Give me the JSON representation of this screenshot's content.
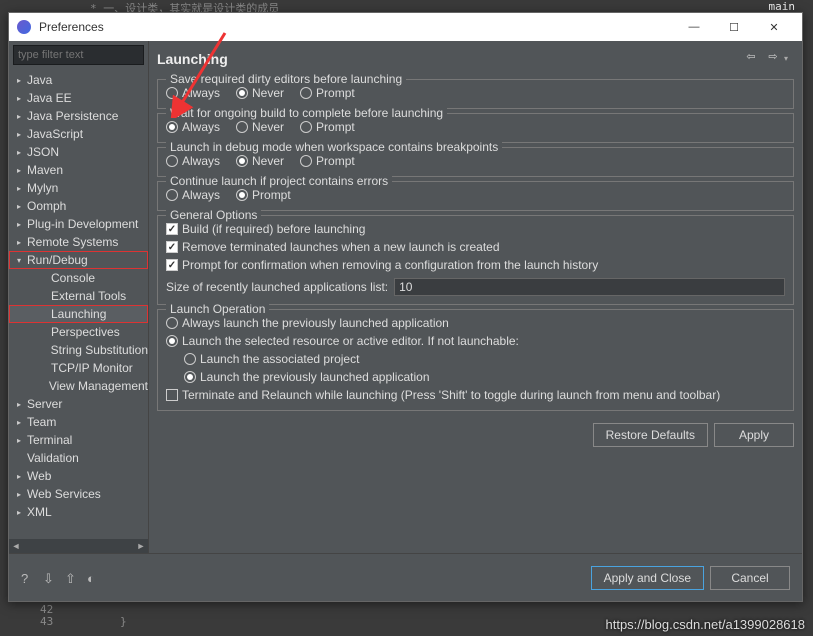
{
  "window": {
    "title": "Preferences"
  },
  "filter": {
    "placeholder": "type filter text"
  },
  "tree": [
    {
      "label": "Java",
      "twisty": "▸",
      "indent": 0
    },
    {
      "label": "Java EE",
      "twisty": "▸",
      "indent": 0
    },
    {
      "label": "Java Persistence",
      "twisty": "▸",
      "indent": 0
    },
    {
      "label": "JavaScript",
      "twisty": "▸",
      "indent": 0
    },
    {
      "label": "JSON",
      "twisty": "▸",
      "indent": 0
    },
    {
      "label": "Maven",
      "twisty": "▸",
      "indent": 0
    },
    {
      "label": "Mylyn",
      "twisty": "▸",
      "indent": 0
    },
    {
      "label": "Oomph",
      "twisty": "▸",
      "indent": 0
    },
    {
      "label": "Plug-in Development",
      "twisty": "▸",
      "indent": 0
    },
    {
      "label": "Remote Systems",
      "twisty": "▸",
      "indent": 0
    },
    {
      "label": "Run/Debug",
      "twisty": "▾",
      "indent": 0,
      "hl": true
    },
    {
      "label": "Console",
      "twisty": "",
      "indent": 1
    },
    {
      "label": "External Tools",
      "twisty": "",
      "indent": 1
    },
    {
      "label": "Launching",
      "twisty": "",
      "indent": 1,
      "sel": true
    },
    {
      "label": "Perspectives",
      "twisty": "",
      "indent": 1
    },
    {
      "label": "String Substitution",
      "twisty": "",
      "indent": 1
    },
    {
      "label": "TCP/IP Monitor",
      "twisty": "",
      "indent": 1
    },
    {
      "label": "View Management",
      "twisty": "",
      "indent": 1
    },
    {
      "label": "Server",
      "twisty": "▸",
      "indent": 0
    },
    {
      "label": "Team",
      "twisty": "▸",
      "indent": 0
    },
    {
      "label": "Terminal",
      "twisty": "▸",
      "indent": 0
    },
    {
      "label": "Validation",
      "twisty": "",
      "indent": 0
    },
    {
      "label": "Web",
      "twisty": "▸",
      "indent": 0
    },
    {
      "label": "Web Services",
      "twisty": "▸",
      "indent": 0
    },
    {
      "label": "XML",
      "twisty": "▸",
      "indent": 0
    }
  ],
  "content": {
    "title": "Launching",
    "groups": {
      "save": {
        "legend": "Save required dirty editors before launching",
        "options": [
          "Always",
          "Never",
          "Prompt"
        ],
        "selected": 1
      },
      "wait": {
        "legend": "Wait for ongoing build to complete before launching",
        "options": [
          "Always",
          "Never",
          "Prompt"
        ],
        "selected": 0
      },
      "debug": {
        "legend": "Launch in debug mode when workspace contains breakpoints",
        "options": [
          "Always",
          "Never",
          "Prompt"
        ],
        "selected": 1
      },
      "errors": {
        "legend": "Continue launch if project contains errors",
        "options": [
          "Always",
          "Prompt"
        ],
        "selected": 1
      },
      "general": {
        "legend": "General Options",
        "checks": [
          {
            "label": "Build (if required) before launching",
            "on": true
          },
          {
            "label": "Remove terminated launches when a new launch is created",
            "on": true
          },
          {
            "label": "Prompt for confirmation when removing a configuration from the launch history",
            "on": true
          }
        ],
        "size_label": "Size of recently launched applications list:",
        "size_value": "10"
      },
      "operation": {
        "legend": "Launch Operation",
        "opt_prev": "Always launch the previously launched application",
        "opt_sel": "Launch the selected resource or active editor. If not launchable:",
        "sub_assoc": "Launch the associated project",
        "sub_prev": "Launch the previously launched application",
        "terminate": "Terminate and Relaunch while launching (Press 'Shift' to toggle during launch from menu and toolbar)"
      }
    },
    "buttons": {
      "restore": "Restore Defaults",
      "apply": "Apply"
    }
  },
  "footer": {
    "apply_close": "Apply and Close",
    "cancel": "Cancel"
  },
  "watermark": "https://blog.csdn.net/a1399028618",
  "bg": {
    "line1": "* 一、设计类，其实就是设计类的成员",
    "line42": "42",
    "line43": "43",
    "brace": "}",
    "tab": "main"
  }
}
